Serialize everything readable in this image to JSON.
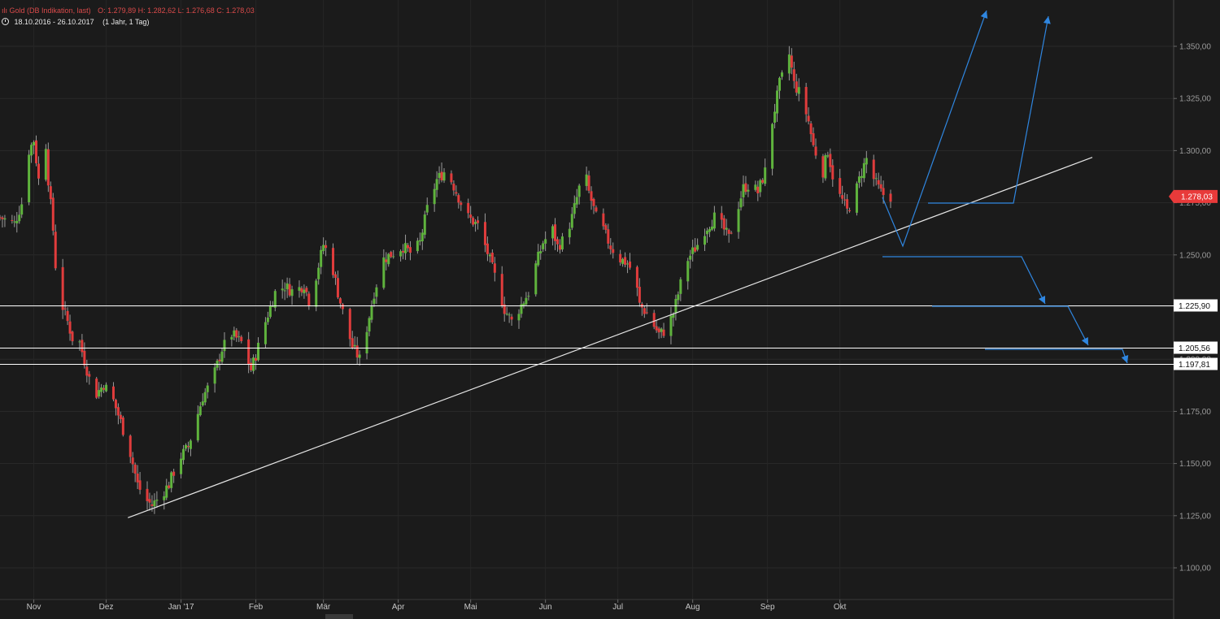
{
  "header": {
    "instrument": "Gold (DB Indikation, last)",
    "ohlc": "O: 1.279,89  H: 1.282,62  L: 1.276,68  C: 1.278,03",
    "period": "18.10.2016 - 26.10.2017",
    "range": "(1 Jahr, 1 Tag)"
  },
  "colors": {
    "background": "#1b1b1b",
    "up_candle": "#5fb33d",
    "down_candle": "#e03c3c",
    "wick": "#9a9a9a",
    "support_lines": "#ffffff",
    "trendline": "#e6e6e6",
    "projection_arrows": "#2f86e0",
    "last_price_tag": "#e83a3a"
  },
  "chart_data": {
    "type": "candlestick",
    "title": "Gold (DB Indikation, last)",
    "x_range": [
      "18.10.2016",
      "26.10.2017"
    ],
    "ylim": [
      1085,
      1370
    ],
    "y_ticks": [
      1100,
      1125,
      1150,
      1175,
      1200,
      1225,
      1250,
      1275,
      1300,
      1325,
      1350
    ],
    "y_tick_labels": [
      "1.100,00",
      "1.125,00",
      "1.150,00",
      "1.175,00",
      "1.200,00",
      "1.225,00",
      "1.250,00",
      "1.275,00",
      "1.300,00",
      "1.325,00",
      "1.350,00"
    ],
    "x_tick_labels": [
      "Nov",
      "Dez",
      "Jan '17",
      "Feb",
      "Mär",
      "Apr",
      "Mai",
      "Jun",
      "Jul",
      "Aug",
      "Sep",
      "Okt"
    ],
    "x_tick_days": [
      14,
      44,
      75,
      106,
      134,
      165,
      195,
      226,
      256,
      287,
      318,
      348
    ],
    "grid": true,
    "price_path": [
      [
        0,
        1268
      ],
      [
        6,
        1265
      ],
      [
        10,
        1278
      ],
      [
        12,
        1300
      ],
      [
        14,
        1305
      ],
      [
        16,
        1286
      ],
      [
        18,
        1320
      ],
      [
        20,
        1286
      ],
      [
        22,
        1262
      ],
      [
        24,
        1228
      ],
      [
        26,
        1225
      ],
      [
        28,
        1218
      ],
      [
        30,
        1210
      ],
      [
        33,
        1208
      ],
      [
        36,
        1195
      ],
      [
        39,
        1182
      ],
      [
        43,
        1188
      ],
      [
        47,
        1180
      ],
      [
        50,
        1170
      ],
      [
        54,
        1155
      ],
      [
        57,
        1140
      ],
      [
        60,
        1133
      ],
      [
        63,
        1130
      ],
      [
        66,
        1134
      ],
      [
        70,
        1140
      ],
      [
        74,
        1152
      ],
      [
        78,
        1158
      ],
      [
        81,
        1170
      ],
      [
        84,
        1182
      ],
      [
        88,
        1190
      ],
      [
        92,
        1205
      ],
      [
        96,
        1212
      ],
      [
        100,
        1208
      ],
      [
        104,
        1195
      ],
      [
        106,
        1202
      ],
      [
        110,
        1218
      ],
      [
        114,
        1232
      ],
      [
        118,
        1235
      ],
      [
        122,
        1232
      ],
      [
        126,
        1236
      ],
      [
        128,
        1228
      ],
      [
        131,
        1240
      ],
      [
        134,
        1255
      ],
      [
        137,
        1248
      ],
      [
        140,
        1232
      ],
      [
        143,
        1218
      ],
      [
        146,
        1206
      ],
      [
        149,
        1200
      ],
      [
        152,
        1215
      ],
      [
        155,
        1232
      ],
      [
        159,
        1248
      ],
      [
        163,
        1251
      ],
      [
        167,
        1254
      ],
      [
        171,
        1250
      ],
      [
        174,
        1256
      ],
      [
        177,
        1272
      ],
      [
        181,
        1286
      ],
      [
        185,
        1291
      ],
      [
        188,
        1283
      ],
      [
        191,
        1275
      ],
      [
        194,
        1268
      ],
      [
        198,
        1264
      ],
      [
        202,
        1251
      ],
      [
        206,
        1236
      ],
      [
        209,
        1224
      ],
      [
        212,
        1218
      ],
      [
        215,
        1224
      ],
      [
        219,
        1232
      ],
      [
        222,
        1245
      ],
      [
        225,
        1256
      ],
      [
        229,
        1262
      ],
      [
        231,
        1254
      ],
      [
        234,
        1258
      ],
      [
        237,
        1268
      ],
      [
        240,
        1282
      ],
      [
        242,
        1292
      ],
      [
        244,
        1280
      ],
      [
        247,
        1268
      ],
      [
        250,
        1262
      ],
      [
        253,
        1254
      ],
      [
        257,
        1248
      ],
      [
        260,
        1246
      ],
      [
        263,
        1240
      ],
      [
        265,
        1226
      ],
      [
        268,
        1222
      ],
      [
        270,
        1218
      ],
      [
        273,
        1212
      ],
      [
        276,
        1214
      ],
      [
        279,
        1222
      ],
      [
        282,
        1236
      ],
      [
        285,
        1248
      ],
      [
        289,
        1255
      ],
      [
        292,
        1262
      ],
      [
        296,
        1268
      ],
      [
        299,
        1264
      ],
      [
        302,
        1258
      ],
      [
        305,
        1270
      ],
      [
        308,
        1282
      ],
      [
        311,
        1284
      ],
      [
        314,
        1280
      ],
      [
        317,
        1290
      ],
      [
        319,
        1308
      ],
      [
        321,
        1320
      ],
      [
        323,
        1332
      ],
      [
        325,
        1338
      ],
      [
        327,
        1346
      ],
      [
        329,
        1332
      ],
      [
        331,
        1328
      ],
      [
        333,
        1322
      ],
      [
        335,
        1314
      ],
      [
        337,
        1302
      ],
      [
        339,
        1296
      ],
      [
        341,
        1290
      ],
      [
        343,
        1300
      ],
      [
        345,
        1288
      ],
      [
        347,
        1280
      ],
      [
        349,
        1276
      ],
      [
        351,
        1271
      ],
      [
        353,
        1276
      ],
      [
        355,
        1282
      ],
      [
        357,
        1290
      ],
      [
        359,
        1296
      ],
      [
        361,
        1289
      ],
      [
        363,
        1284
      ],
      [
        365,
        1280
      ],
      [
        367,
        1278
      ],
      [
        369,
        1278
      ]
    ],
    "trendline": {
      "from": [
        "10.12.2016",
        1124
      ],
      "to": [
        "09.10.2017",
        1255
      ]
    },
    "support_levels": [
      {
        "value": 1225.9,
        "label": "1.225,90"
      },
      {
        "value": 1205.56,
        "label": "1.205,56"
      },
      {
        "value": 1197.81,
        "label": "1.197,81"
      }
    ],
    "last_price": {
      "value": 1278.03,
      "label": "1.278,03"
    }
  }
}
